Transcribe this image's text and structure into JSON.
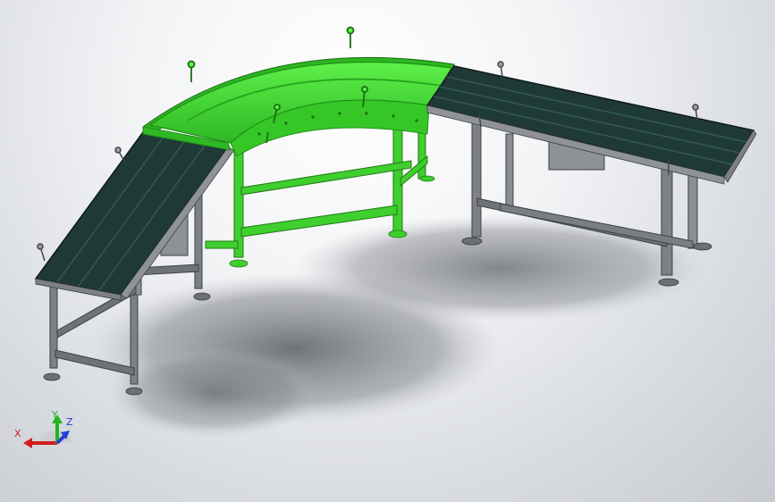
{
  "viewport": {
    "background": "#e6e8eb",
    "subject": "conveyor-assembly"
  },
  "colors": {
    "curve_green": "#39d12b",
    "curve_green_dark": "#1f8f17",
    "belt": "#1f3a36",
    "belt_slat": "#2c524c",
    "frame": "#7d8186",
    "frame_dark": "#3d4044",
    "shadow": "#6e7178",
    "axis_x": "#d11b1b",
    "axis_y": "#22b322",
    "axis_z": "#2340d6"
  },
  "triad": {
    "x_label": "X",
    "y_label": "Y",
    "z_label": "Z"
  }
}
